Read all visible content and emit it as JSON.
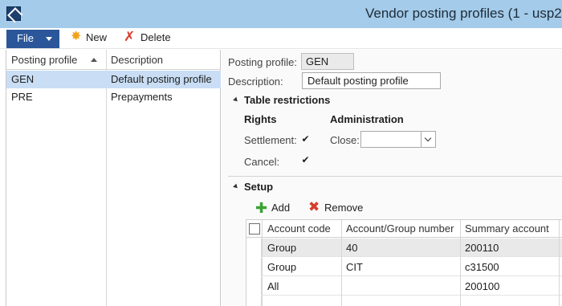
{
  "window": {
    "title": "Vendor posting profiles (1 - usp2"
  },
  "toolbar": {
    "file_label": "File",
    "new_label": "New",
    "delete_label": "Delete"
  },
  "list": {
    "columns": [
      "Posting profile",
      "Description"
    ],
    "rows": [
      {
        "profile": "GEN",
        "description": "Default posting profile",
        "selected": true
      },
      {
        "profile": "PRE",
        "description": "Prepayments",
        "selected": false
      }
    ]
  },
  "detail": {
    "posting_profile_label": "Posting profile:",
    "posting_profile_value": "GEN",
    "description_label": "Description:",
    "description_value": "Default posting profile"
  },
  "table_restrictions": {
    "title": "Table restrictions",
    "rights_title": "Rights",
    "administration_title": "Administration",
    "settlement_label": "Settlement:",
    "settlement_checked": true,
    "cancel_label": "Cancel:",
    "cancel_checked": true,
    "close_label": "Close:",
    "close_value": ""
  },
  "setup": {
    "title": "Setup",
    "add_label": "Add",
    "remove_label": "Remove",
    "columns": [
      "Account code",
      "Account/Group number",
      "Summary account"
    ],
    "rows": [
      {
        "account_code": "Group",
        "group_number": "40",
        "summary_account": "200110",
        "selected": true
      },
      {
        "account_code": "Group",
        "group_number": "CIT",
        "summary_account": "c31500",
        "selected": false
      },
      {
        "account_code": "All",
        "group_number": "",
        "summary_account": "200100",
        "selected": false
      }
    ]
  },
  "colors": {
    "title_bar": "#a4cbe9",
    "file_button": "#2b579a",
    "selection": "#c9def5"
  }
}
